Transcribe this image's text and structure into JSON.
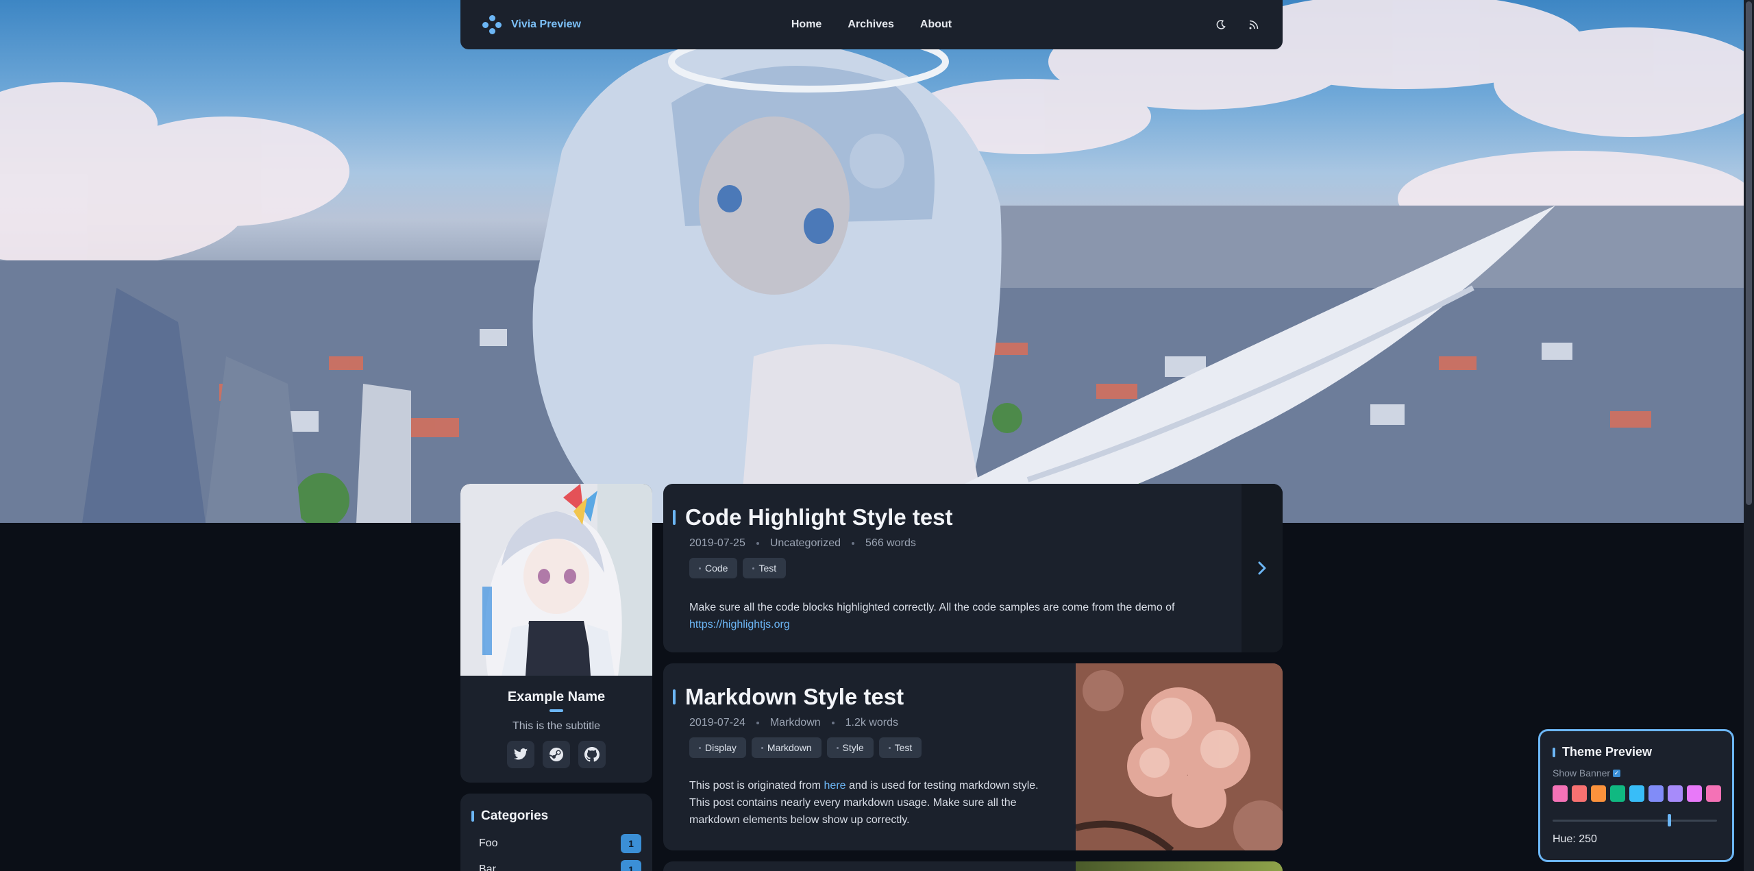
{
  "brand": {
    "name": "Vivia Preview"
  },
  "nav": {
    "links": [
      "Home",
      "Archives",
      "About"
    ]
  },
  "profile": {
    "name": "Example Name",
    "subtitle": "This is the subtitle"
  },
  "categories": {
    "title": "Categories",
    "items": [
      {
        "name": "Foo",
        "count": "1"
      },
      {
        "name": "Bar",
        "count": "1"
      }
    ]
  },
  "posts": [
    {
      "title": "Code Highlight Style test",
      "date": "2019-07-25",
      "category": "Uncategorized",
      "words": "566 words",
      "tags": [
        "Code",
        "Test"
      ],
      "excerpt_text": "Make sure all the code blocks highlighted correctly. All the code samples are come from the demo of",
      "excerpt_link": "https://highlightjs.org"
    },
    {
      "title": "Markdown Style test",
      "date": "2019-07-24",
      "category": "Markdown",
      "words": "1.2k words",
      "tags": [
        "Display",
        "Markdown",
        "Style",
        "Test"
      ],
      "excerpt_before": "This post is originated from",
      "excerpt_link": "here",
      "excerpt_after": "and is used for testing markdown style. This post contains nearly every markdown usage. Make sure all the markdown elements below show up correctly."
    }
  ],
  "theme_preview": {
    "title": "Theme Preview",
    "show_banner_label": "Show Banner",
    "show_banner_checked": true,
    "swatch_colors": [
      "#f472b6",
      "#f87171",
      "#fb923c",
      "#10b981",
      "#38bdf8",
      "#818cf8",
      "#a78bfa",
      "#e879f9",
      "#f472b6"
    ],
    "hue_label": "Hue: 250",
    "hue_value": 250
  },
  "colors": {
    "accent": "#6cb6f5",
    "card": "#1b212c",
    "background": "#0b0f17"
  },
  "icons": [
    "brand-dots-icon",
    "moon-icon",
    "rss-icon",
    "twitter-icon",
    "steam-icon",
    "github-icon",
    "chevron-right-icon"
  ]
}
